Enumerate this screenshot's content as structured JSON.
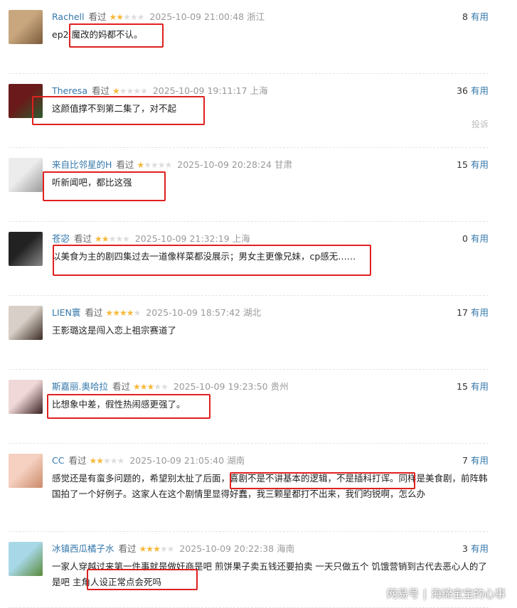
{
  "seen_label": "看过",
  "useful_label": "有用",
  "report_label": "投诉",
  "colors": {
    "name": "#3377aa",
    "star": "#f7b83a",
    "highlight": "#e02020"
  },
  "comments": [
    {
      "name": "Rachell",
      "stars": 2,
      "time": "2025-10-09 21:00:48",
      "location": "浙江",
      "votes": "8",
      "text": "ep2 魔改的妈都不认。",
      "avatar_colors": [
        "#c8a77e",
        "#7a5a3a"
      ]
    },
    {
      "name": "Theresa",
      "stars": 1,
      "time": "2025-10-09 19:11:17",
      "location": "上海",
      "votes": "36",
      "text": "这颜值撑不到第二集了，对不起",
      "avatar_colors": [
        "#6a1a1a",
        "#2f5a2f"
      ]
    },
    {
      "name": "来自比邻星的H",
      "stars": 1,
      "time": "2025-10-09 20:28:24",
      "location": "甘肃",
      "votes": "15",
      "text": "听新闻吧，都比这强",
      "avatar_colors": [
        "#ececec",
        "#9a9a9a"
      ]
    },
    {
      "name": "苍宓",
      "stars": 2,
      "time": "2025-10-09 21:32:19",
      "location": "上海",
      "votes": "0",
      "text": "以美食为主的剧四集过去一道像样菜都没展示；男女主更像兄妹，cp感无……",
      "avatar_colors": [
        "#222",
        "#888"
      ]
    },
    {
      "name": "LIEN寰",
      "stars": 4,
      "time": "2025-10-09 18:57:42",
      "location": "湖北",
      "votes": "17",
      "text": "王影璐这是闯入恋上祖宗赛道了",
      "avatar_colors": [
        "#d8d0c8",
        "#3a2a22"
      ]
    },
    {
      "name": "斯嘉丽.奥哈拉",
      "stars": 3,
      "time": "2025-10-09 19:23:50",
      "location": "贵州",
      "votes": "15",
      "text": "比想象中差，假性热闹感更强了。",
      "avatar_colors": [
        "#f0d8d8",
        "#3a2020"
      ]
    },
    {
      "name": "CC",
      "stars": 2,
      "time": "2025-10-09 21:05:40",
      "location": "湖南",
      "votes": "7",
      "text": "感觉还是有蛮多问题的，希望别太扯了后面，喜剧不是不讲基本的逻辑，不是插科打诨。同样是美食剧，前阵韩国拍了一个好例子。这家人在这个剧情里显得好蠢，我三颗星都打不出来，我们昀锐啊，怎么办",
      "avatar_colors": [
        "#f6d0c0",
        "#c98a6a"
      ]
    },
    {
      "name": "冰镇西瓜橘子水",
      "stars": 3,
      "time": "2025-10-09 20:22:38",
      "location": "海南",
      "votes": "3",
      "text": "一家人穿越过来第一件事就是做奸商是吧 煎饼果子卖五钱还要拍卖 一天只做五个 饥饿营销到古代去恶心人的了是吧 主角人设正常点会死吗",
      "avatar_colors": [
        "#a8d8e8",
        "#5a8a3a"
      ]
    }
  ],
  "watermark": {
    "brand": "网易号",
    "author": "海绵宝宝的心事"
  }
}
